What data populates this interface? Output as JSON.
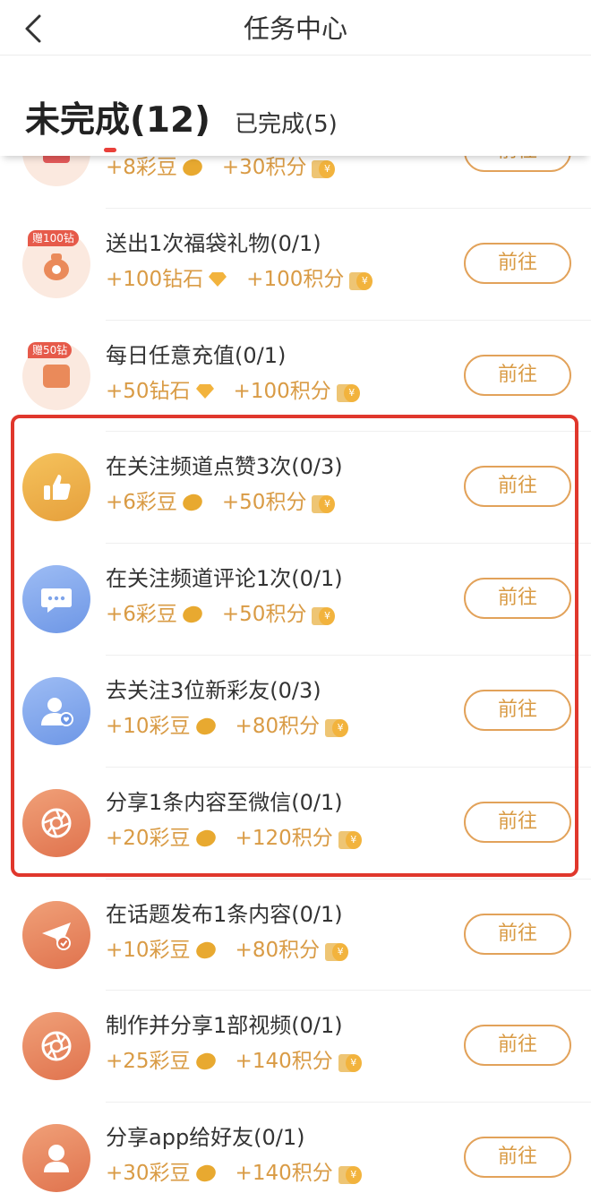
{
  "header": {
    "title": "任务中心",
    "back_icon": "chevron-left-icon"
  },
  "tabs": {
    "active": "未完成(12)",
    "inactive": "已完成(5)",
    "indicator_color": "#e9403a"
  },
  "colors": {
    "reward_text": "#d99b45",
    "button_border": "#e2a25a",
    "highlight_frame": "#e0372c"
  },
  "tasks": [
    {
      "title": "",
      "reward1": "+8彩豆",
      "reward1_icon": "bean-icon",
      "reward2": "+30积分",
      "reward2_icon": "coin-icon",
      "button": "前往",
      "icon": "gift-icon"
    },
    {
      "title": "送出1次福袋礼物(0/1)",
      "badge": "赠100钻",
      "reward1": "+100钻石",
      "reward1_icon": "diamond-icon",
      "reward2": "+100积分",
      "reward2_icon": "coin-icon",
      "button": "前往",
      "icon": "lucky-bag-icon"
    },
    {
      "title": "每日任意充值(0/1)",
      "badge": "赠50钻",
      "reward1": "+50钻石",
      "reward1_icon": "diamond-icon",
      "reward2": "+100积分",
      "reward2_icon": "coin-icon",
      "button": "前往",
      "icon": "wallet-icon"
    },
    {
      "title": "在关注频道点赞3次(0/3)",
      "reward1": "+6彩豆",
      "reward1_icon": "bean-icon",
      "reward2": "+50积分",
      "reward2_icon": "coin-icon",
      "button": "前往",
      "icon": "thumbs-up-icon"
    },
    {
      "title": "在关注频道评论1次(0/1)",
      "reward1": "+6彩豆",
      "reward1_icon": "bean-icon",
      "reward2": "+50积分",
      "reward2_icon": "coin-icon",
      "button": "前往",
      "icon": "comment-icon"
    },
    {
      "title": "去关注3位新彩友(0/3)",
      "reward1": "+10彩豆",
      "reward1_icon": "bean-icon",
      "reward2": "+80积分",
      "reward2_icon": "coin-icon",
      "button": "前往",
      "icon": "follow-user-icon"
    },
    {
      "title": "分享1条内容至微信(0/1)",
      "reward1": "+20彩豆",
      "reward1_icon": "bean-icon",
      "reward2": "+120积分",
      "reward2_icon": "coin-icon",
      "button": "前往",
      "icon": "aperture-icon"
    },
    {
      "title": "在话题发布1条内容(0/1)",
      "reward1": "+10彩豆",
      "reward1_icon": "bean-icon",
      "reward2": "+80积分",
      "reward2_icon": "coin-icon",
      "button": "前往",
      "icon": "send-icon"
    },
    {
      "title": "制作并分享1部视频(0/1)",
      "reward1": "+25彩豆",
      "reward1_icon": "bean-icon",
      "reward2": "+140积分",
      "reward2_icon": "coin-icon",
      "button": "前往",
      "icon": "aperture-icon"
    },
    {
      "title": "分享app给好友(0/1)",
      "reward1": "+30彩豆",
      "reward1_icon": "bean-icon",
      "reward2": "+140积分",
      "reward2_icon": "coin-icon",
      "button": "前往",
      "icon": "user-icon"
    }
  ]
}
